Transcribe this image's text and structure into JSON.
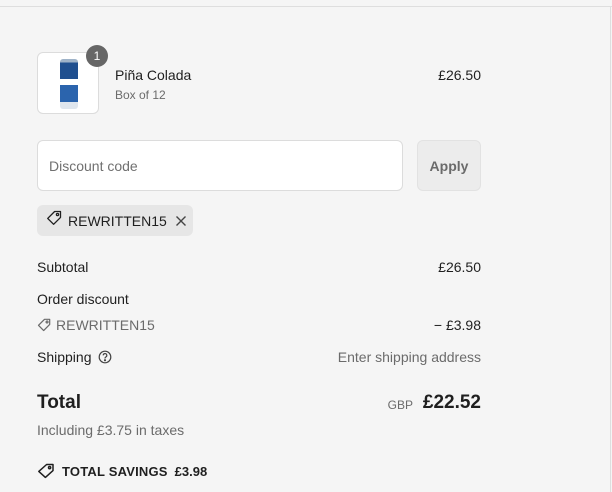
{
  "cart": {
    "item_count": "1",
    "product": {
      "name": "Piña Colada",
      "variant": "Box of 12",
      "price": "£26.50"
    }
  },
  "discount": {
    "placeholder": "Discount code",
    "apply_label": "Apply",
    "applied_code": "REWRITTEN15"
  },
  "summary": {
    "subtotal_label": "Subtotal",
    "subtotal_value": "£26.50",
    "order_discount_label": "Order discount",
    "discount_code": "REWRITTEN15",
    "discount_value": "− £3.98",
    "shipping_label": "Shipping",
    "shipping_value": "Enter shipping address",
    "total_label": "Total",
    "currency": "GBP",
    "total_value": "£22.52",
    "tax_note": "Including £3.75 in taxes",
    "savings_label": "TOTAL SAVINGS",
    "savings_value": "£3.98"
  },
  "icons": {
    "tag": "tag-icon",
    "close": "close-icon",
    "help": "help-circle-icon",
    "savings": "savings-tag-icon"
  }
}
